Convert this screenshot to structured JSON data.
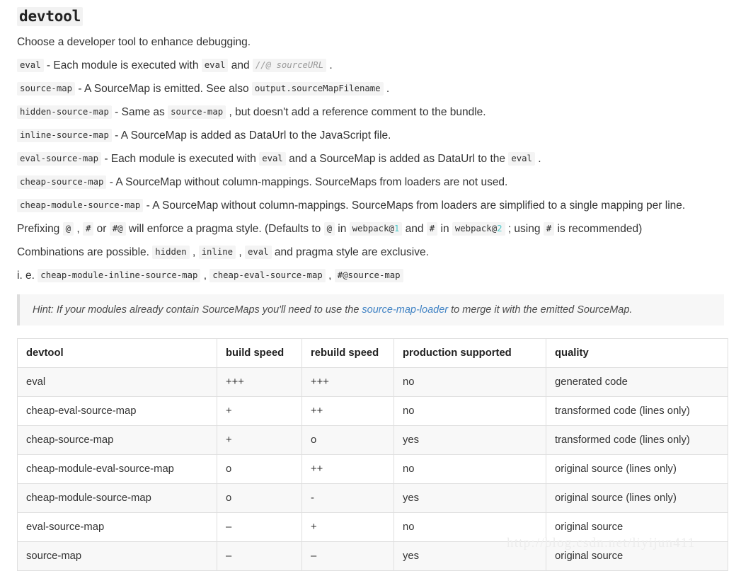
{
  "heading": {
    "text": "devtool"
  },
  "paragraphs": [
    {
      "id": "intro",
      "parts": [
        {
          "type": "text",
          "value": "Choose a developer tool to enhance debugging."
        }
      ]
    },
    {
      "id": "eval",
      "parts": [
        {
          "type": "code",
          "value": "eval"
        },
        {
          "type": "text",
          "value": " - Each module is executed with "
        },
        {
          "type": "code",
          "value": "eval"
        },
        {
          "type": "text",
          "value": " and "
        },
        {
          "type": "code-comment",
          "value": "//@ sourceURL"
        },
        {
          "type": "text",
          "value": " ."
        }
      ]
    },
    {
      "id": "source-map",
      "parts": [
        {
          "type": "code",
          "value": "source-map"
        },
        {
          "type": "text",
          "value": " - A SourceMap is emitted. See also "
        },
        {
          "type": "code",
          "value": "output.sourceMapFilename"
        },
        {
          "type": "text",
          "value": " ."
        }
      ]
    },
    {
      "id": "hidden-source-map",
      "parts": [
        {
          "type": "code",
          "value": "hidden-source-map"
        },
        {
          "type": "text",
          "value": " - Same as "
        },
        {
          "type": "code",
          "value": "source-map"
        },
        {
          "type": "text",
          "value": " , but doesn't add a reference comment to the bundle."
        }
      ]
    },
    {
      "id": "inline-source-map",
      "parts": [
        {
          "type": "code",
          "value": "inline-source-map"
        },
        {
          "type": "text",
          "value": " - A SourceMap is added as DataUrl to the JavaScript file."
        }
      ]
    },
    {
      "id": "eval-source-map",
      "parts": [
        {
          "type": "code",
          "value": "eval-source-map"
        },
        {
          "type": "text",
          "value": " - Each module is executed with "
        },
        {
          "type": "code",
          "value": "eval"
        },
        {
          "type": "text",
          "value": " and a SourceMap is added as DataUrl to the "
        },
        {
          "type": "code",
          "value": "eval"
        },
        {
          "type": "text",
          "value": " ."
        }
      ]
    },
    {
      "id": "cheap-source-map",
      "parts": [
        {
          "type": "code",
          "value": "cheap-source-map"
        },
        {
          "type": "text",
          "value": " - A SourceMap without column-mappings. SourceMaps from loaders are not used."
        }
      ]
    },
    {
      "id": "cheap-module-source-map",
      "parts": [
        {
          "type": "code",
          "value": "cheap-module-source-map"
        },
        {
          "type": "text",
          "value": " - A SourceMap without column-mappings. SourceMaps from loaders are simplified to a single mapping per line."
        }
      ]
    },
    {
      "id": "prefixing",
      "parts": [
        {
          "type": "text",
          "value": "Prefixing "
        },
        {
          "type": "code",
          "value": "@"
        },
        {
          "type": "text",
          "value": " , "
        },
        {
          "type": "code",
          "value": "#"
        },
        {
          "type": "text",
          "value": " or "
        },
        {
          "type": "code",
          "value": "#@"
        },
        {
          "type": "text",
          "value": " will enforce a pragma style. (Defaults to "
        },
        {
          "type": "code",
          "value": "@"
        },
        {
          "type": "text",
          "value": " in "
        },
        {
          "type": "code-num",
          "value": "webpack@",
          "num": "1"
        },
        {
          "type": "text",
          "value": " and "
        },
        {
          "type": "code",
          "value": "#"
        },
        {
          "type": "text",
          "value": " in "
        },
        {
          "type": "code-num",
          "value": "webpack@",
          "num": "2"
        },
        {
          "type": "text",
          "value": " ; using "
        },
        {
          "type": "code",
          "value": "#"
        },
        {
          "type": "text",
          "value": " is recommended)"
        }
      ]
    },
    {
      "id": "combinations",
      "parts": [
        {
          "type": "text",
          "value": "Combinations are possible. "
        },
        {
          "type": "code",
          "value": "hidden"
        },
        {
          "type": "text",
          "value": " , "
        },
        {
          "type": "code",
          "value": "inline"
        },
        {
          "type": "text",
          "value": " , "
        },
        {
          "type": "code",
          "value": "eval"
        },
        {
          "type": "text",
          "value": " and pragma style are exclusive."
        }
      ]
    },
    {
      "id": "ie",
      "parts": [
        {
          "type": "text",
          "value": "i. e. "
        },
        {
          "type": "code",
          "value": "cheap-module-inline-source-map"
        },
        {
          "type": "text",
          "value": " , "
        },
        {
          "type": "code",
          "value": "cheap-eval-source-map"
        },
        {
          "type": "text",
          "value": " , "
        },
        {
          "type": "code",
          "value": "#@source-map"
        }
      ]
    }
  ],
  "hint": {
    "before": "Hint: If your modules already contain SourceMaps you'll need to use the ",
    "link": "source-map-loader",
    "after": " to merge it with the emitted SourceMap."
  },
  "table": {
    "headers": [
      "devtool",
      "build speed",
      "rebuild speed",
      "production supported",
      "quality"
    ],
    "rows": [
      [
        "eval",
        "+++",
        "+++",
        "no",
        "generated code"
      ],
      [
        "cheap-eval-source-map",
        "+",
        "++",
        "no",
        "transformed code (lines only)"
      ],
      [
        "cheap-source-map",
        "+",
        "o",
        "yes",
        "transformed code (lines only)"
      ],
      [
        "cheap-module-eval-source-map",
        "o",
        "++",
        "no",
        "original source (lines only)"
      ],
      [
        "cheap-module-source-map",
        "o",
        "-",
        "yes",
        "original source (lines only)"
      ],
      [
        "eval-source-map",
        "–",
        "+",
        "no",
        "original source"
      ],
      [
        "source-map",
        "–",
        "–",
        "yes",
        "original source"
      ]
    ]
  },
  "watermark": {
    "text": "http://blog.csdn.net/liyijun411"
  },
  "colors": {
    "link": "#4183c4",
    "code_bg": "#f4f4f4",
    "hint_bg": "#f7f7f7",
    "hint_border": "#dddddd",
    "table_border": "#dfdfdf",
    "row_stripe": "#f8f8f8",
    "num_accent": "#4ec9c9",
    "watermark": "#ededed"
  }
}
